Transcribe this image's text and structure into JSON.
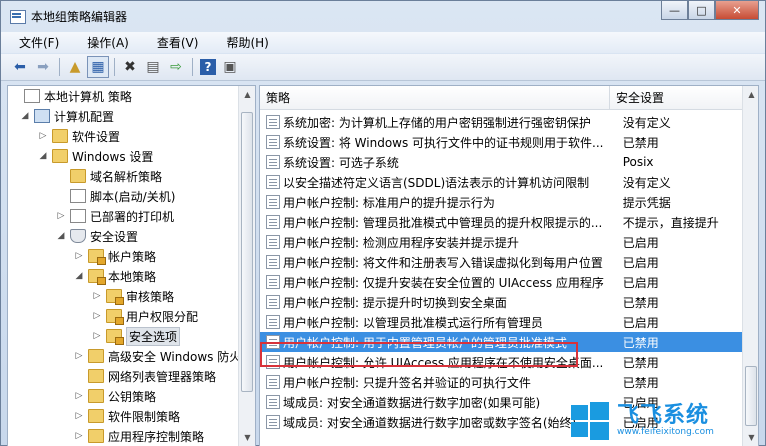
{
  "window": {
    "title": "本地组策略编辑器",
    "min": "—",
    "max": "□",
    "close": "✕"
  },
  "menu": [
    "文件(F)",
    "操作(A)",
    "查看(V)",
    "帮助(H)"
  ],
  "toolbar_icons": [
    "back-icon",
    "forward-icon",
    "up-folder-icon",
    "show-tree-icon",
    "delete-icon",
    "properties-icon",
    "export-icon",
    "help-icon",
    "view-icon"
  ],
  "tree": [
    {
      "label": "本地计算机 策略",
      "icon": "doc",
      "exp": ""
    },
    {
      "label": "计算机配置",
      "icon": "comp",
      "exp": "◢"
    },
    {
      "label": "软件设置",
      "icon": "folder",
      "exp": "▷"
    },
    {
      "label": "Windows 设置",
      "icon": "folder",
      "exp": "◢"
    },
    {
      "label": "域名解析策略",
      "icon": "folder",
      "exp": ""
    },
    {
      "label": "脚本(启动/关机)",
      "icon": "doc",
      "exp": ""
    },
    {
      "label": "已部署的打印机",
      "icon": "doc",
      "exp": "▷"
    },
    {
      "label": "安全设置",
      "icon": "shield",
      "exp": "◢"
    },
    {
      "label": "帐户策略",
      "icon": "folder",
      "exp": "▷"
    },
    {
      "label": "本地策略",
      "icon": "folder",
      "exp": "◢"
    },
    {
      "label": "审核策略",
      "icon": "folder",
      "exp": "▷"
    },
    {
      "label": "用户权限分配",
      "icon": "folder",
      "exp": "▷"
    },
    {
      "label": "安全选项",
      "icon": "folder",
      "exp": "▷",
      "selected": true
    },
    {
      "label": "高级安全 Windows 防火",
      "icon": "folder",
      "exp": "▷"
    },
    {
      "label": "网络列表管理器策略",
      "icon": "folder",
      "exp": ""
    },
    {
      "label": "公钥策略",
      "icon": "folder",
      "exp": "▷"
    },
    {
      "label": "软件限制策略",
      "icon": "folder",
      "exp": "▷"
    },
    {
      "label": "应用程序控制策略",
      "icon": "folder",
      "exp": "▷"
    }
  ],
  "list": {
    "col_policy": "策略",
    "col_setting": "安全设置",
    "rows": [
      {
        "policy": "系统加密: 为计算机上存储的用户密钥强制进行强密钥保护",
        "setting": "没有定义"
      },
      {
        "policy": "系统设置: 将 Windows 可执行文件中的证书规则用于软件...",
        "setting": "已禁用"
      },
      {
        "policy": "系统设置: 可选子系统",
        "setting": "Posix"
      },
      {
        "policy": "以安全描述符定义语言(SDDL)语法表示的计算机访问限制",
        "setting": "没有定义"
      },
      {
        "policy": "用户帐户控制: 标准用户的提升提示行为",
        "setting": "提示凭据"
      },
      {
        "policy": "用户帐户控制: 管理员批准模式中管理员的提升权限提示的...",
        "setting": "不提示，直接提升"
      },
      {
        "policy": "用户帐户控制: 检测应用程序安装并提示提升",
        "setting": "已启用"
      },
      {
        "policy": "用户帐户控制: 将文件和注册表写入错误虚拟化到每用户位置",
        "setting": "已启用"
      },
      {
        "policy": "用户帐户控制: 仅提升安装在安全位置的 UIAccess 应用程序",
        "setting": "已启用"
      },
      {
        "policy": "用户帐户控制: 提示提升时切换到安全桌面",
        "setting": "已禁用"
      },
      {
        "policy": "用户帐户控制: 以管理员批准模式运行所有管理员",
        "setting": "已启用"
      },
      {
        "policy": "用户帐户控制: 用于内置管理员帐户的管理员批准模式",
        "setting": "已禁用",
        "selected": true
      },
      {
        "policy": "用户帐户控制: 允许 UIAccess 应用程序在不使用安全桌面...",
        "setting": "已禁用"
      },
      {
        "policy": "用户帐户控制: 只提升签名并验证的可执行文件",
        "setting": "已禁用"
      },
      {
        "policy": "域成员: 对安全通道数据进行数字加密(如果可能)",
        "setting": "已启用"
      },
      {
        "policy": "域成员: 对安全通道数据进行数字加密或数字签名(始终)",
        "setting": "已启用"
      }
    ]
  },
  "watermark": {
    "name": "飞飞系统",
    "url": "www.feifeixitong.com"
  }
}
